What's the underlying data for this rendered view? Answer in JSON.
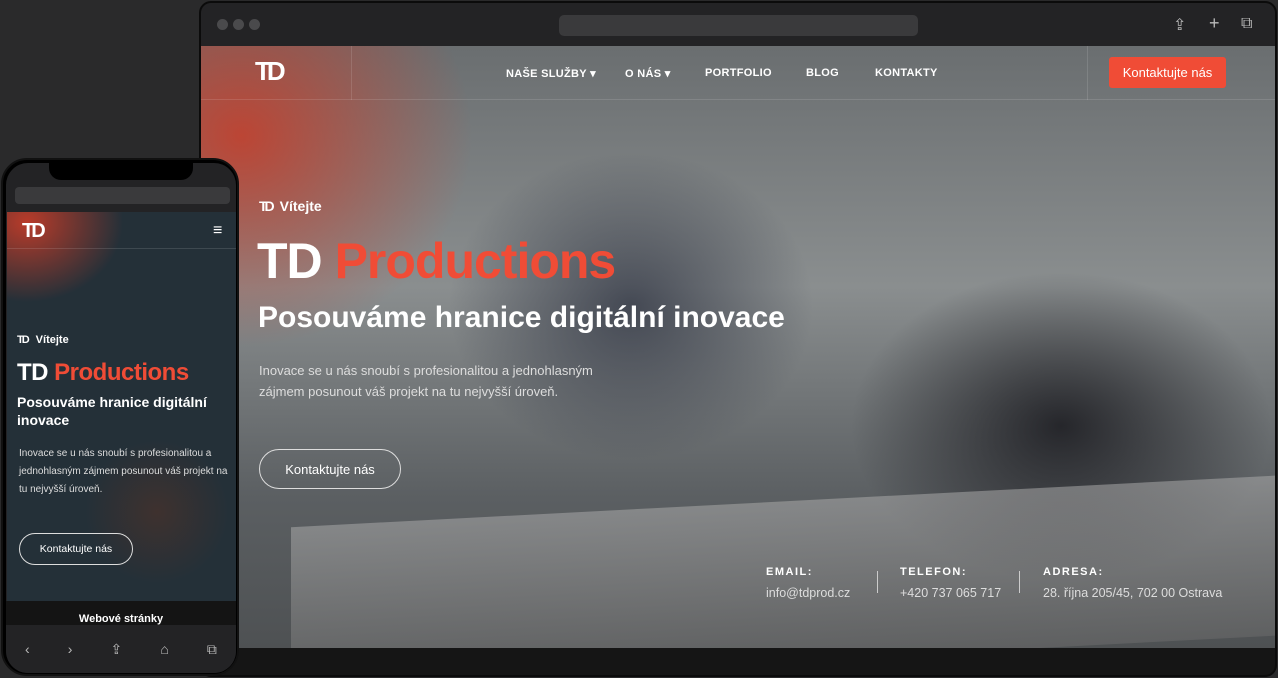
{
  "desktop": {
    "logo": "TD",
    "nav": [
      {
        "label": "NAŠE SLUŽBY ▾"
      },
      {
        "label": "O NÁS ▾"
      },
      {
        "label": "PORTFOLIO"
      },
      {
        "label": "BLOG"
      },
      {
        "label": "KONTAKTY"
      }
    ],
    "cta": "Kontaktujte nás",
    "welcome": "Vítejte",
    "title_white": "TD",
    "title_accent": "Productions",
    "subtitle": "Posouváme hranice digitální inovace",
    "paragraph": "Inovace se u nás snoubí s profesionalitou a jednohlasným zájmem posunout váš projekt na tu nejvyšší úroveň.",
    "button": "Kontaktujte nás",
    "contact": [
      {
        "label": "EMAIL:",
        "value": "info@tdprod.cz"
      },
      {
        "label": "TELEFON:",
        "value": "+420 737 065 717"
      },
      {
        "label": "ADRESA:",
        "value": "28. října 205/45, 702 00 Ostrava"
      }
    ],
    "icons": {
      "share": "⇪",
      "new_tab": "+",
      "tabs": "⧉"
    }
  },
  "mobile": {
    "logo": "TD",
    "menu": "≡",
    "welcome": "Vítejte",
    "title_white": "TD",
    "title_accent": "Productions",
    "subtitle": "Posouváme hranice digitální inovace",
    "paragraph": "Inovace se u nás snoubí s profesionalitou a jednohlasným zájmem posunout váš projekt na tu nejvyšší úroveň.",
    "button": "Kontaktujte nás",
    "next_section": "Webové stránky",
    "toolbar": {
      "back": "‹",
      "forward": "›",
      "share": "⇪",
      "bookmarks": "⌂",
      "tabs": "⧉"
    }
  },
  "colors": {
    "accent": "#f04c36"
  }
}
